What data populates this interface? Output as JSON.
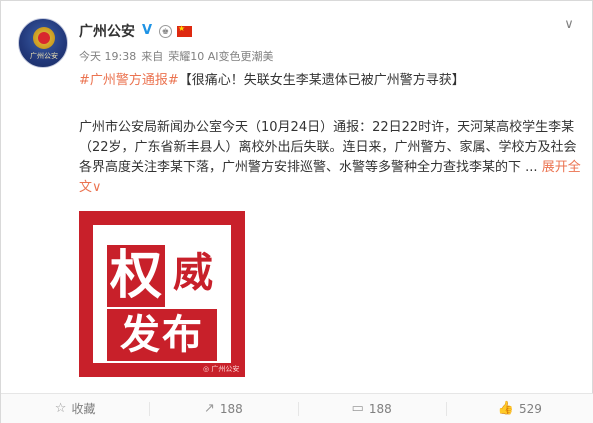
{
  "post": {
    "author": "广州公安",
    "avatar_text": "广州公安",
    "time": "今天 19:38",
    "source_prefix": "来自",
    "source": "荣耀10 AI变色更潮美",
    "hashtag": "#广州警方通报#",
    "headline": "【很痛心！失联女生李某遗体已被广州警方寻获】",
    "body": "广州市公安局新闻办公室今天（10月24日）通报：22日22时许，天河某高校学生李某（22岁，广东省新丰县人）离校外出后失联。连日来，广州警方、家属、学校方及社会各界高度关注李某下落，广州警方安排巡警、水警等多警种全力查找李某的下",
    "ellipsis": " ... ",
    "expand_label": "展开全文",
    "expand_arrow": "∨"
  },
  "image": {
    "char1": "权",
    "char2": "威",
    "char3": "发布",
    "watermark": "◎ 广州公安",
    "bg_color": "#c8202a"
  },
  "icons": {
    "verified": "V",
    "crown": "♚",
    "flag_star": "★",
    "chevron": "∨"
  },
  "actions": {
    "favorite_icon": "☆",
    "favorite_label": "收藏",
    "repost_icon": "↗",
    "repost_count": "188",
    "comment_icon": "▭",
    "comment_count": "188",
    "like_icon": "👍",
    "like_count": "529"
  },
  "colors": {
    "accent": "#eb7350",
    "verified": "#1e93e5",
    "text": "#333333",
    "muted": "#808080"
  }
}
